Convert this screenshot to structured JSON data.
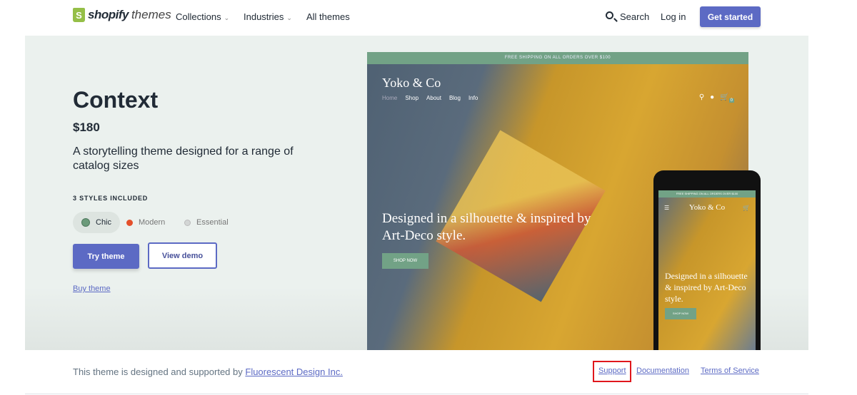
{
  "nav": {
    "logo_bold": "shopify",
    "logo_light": "themes",
    "logo_letter": "S",
    "items": [
      {
        "label": "Collections",
        "chevron": "chevron-down-icon"
      },
      {
        "label": "Industries",
        "chevron": "chevron-down-icon"
      },
      {
        "label": "All themes"
      }
    ],
    "search": "Search",
    "login": "Log in",
    "get_started": "Get started"
  },
  "theme": {
    "name": "Context",
    "price": "$180",
    "description": "A storytelling theme designed for a range of catalog sizes",
    "styles_label": "3 STYLES INCLUDED",
    "styles": [
      {
        "label": "Chic",
        "color": "#6b9a7a",
        "selected": true
      },
      {
        "label": "Modern",
        "color": "#e4502b",
        "selected": false
      },
      {
        "label": "Essential",
        "color": "#d3d6d5",
        "selected": false
      }
    ],
    "try": "Try theme",
    "demo": "View demo",
    "buy": "Buy theme"
  },
  "preview": {
    "shipping": "FREE SHIPPING ON ALL ORDERS OVER $100",
    "brand": "Yoko & Co",
    "menu": [
      "Home",
      "Shop",
      "About",
      "Blog",
      "Info"
    ],
    "cart_count": "0",
    "headline": "Designed in a silhouette & inspired by Art-Deco style.",
    "cta": "SHOP NOW"
  },
  "footer": {
    "text": "This theme is designed and supported by ",
    "designer": "Fluorescent Design Inc.",
    "links": [
      "Support",
      "Documentation",
      "Terms of Service"
    ]
  },
  "colors": {
    "accent": "#5c6ac4",
    "hero_bg": "#ebf1ee",
    "highlight": "#e0171c"
  }
}
